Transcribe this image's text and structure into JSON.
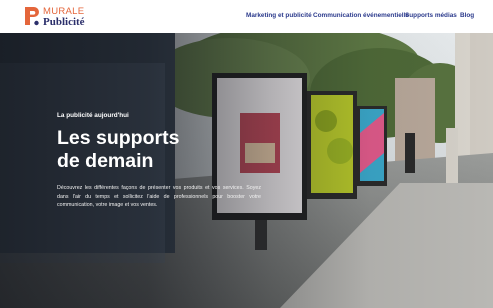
{
  "header": {
    "logo": {
      "line1": "MURALE",
      "line2": "Publicité"
    },
    "nav": [
      {
        "label": "Marketing et publicité"
      },
      {
        "label": "Communication événementielle"
      },
      {
        "label": "Supports médias"
      },
      {
        "label": "Blog"
      }
    ]
  },
  "hero": {
    "eyebrow": "La publicité aujourd'hui",
    "title_line1": "Les supports",
    "title_line2": "de demain",
    "description": "Découvrez les différentes façons de présenter vos produits et vos services. Soyez dans l'air du temps et sollicitez l'aide de professionnels pour booster votre communication, votre image et vos ventes."
  },
  "colors": {
    "brand_orange": "#e4663b",
    "brand_navy": "#2b2f6b",
    "nav_text": "#2b3a8c"
  }
}
